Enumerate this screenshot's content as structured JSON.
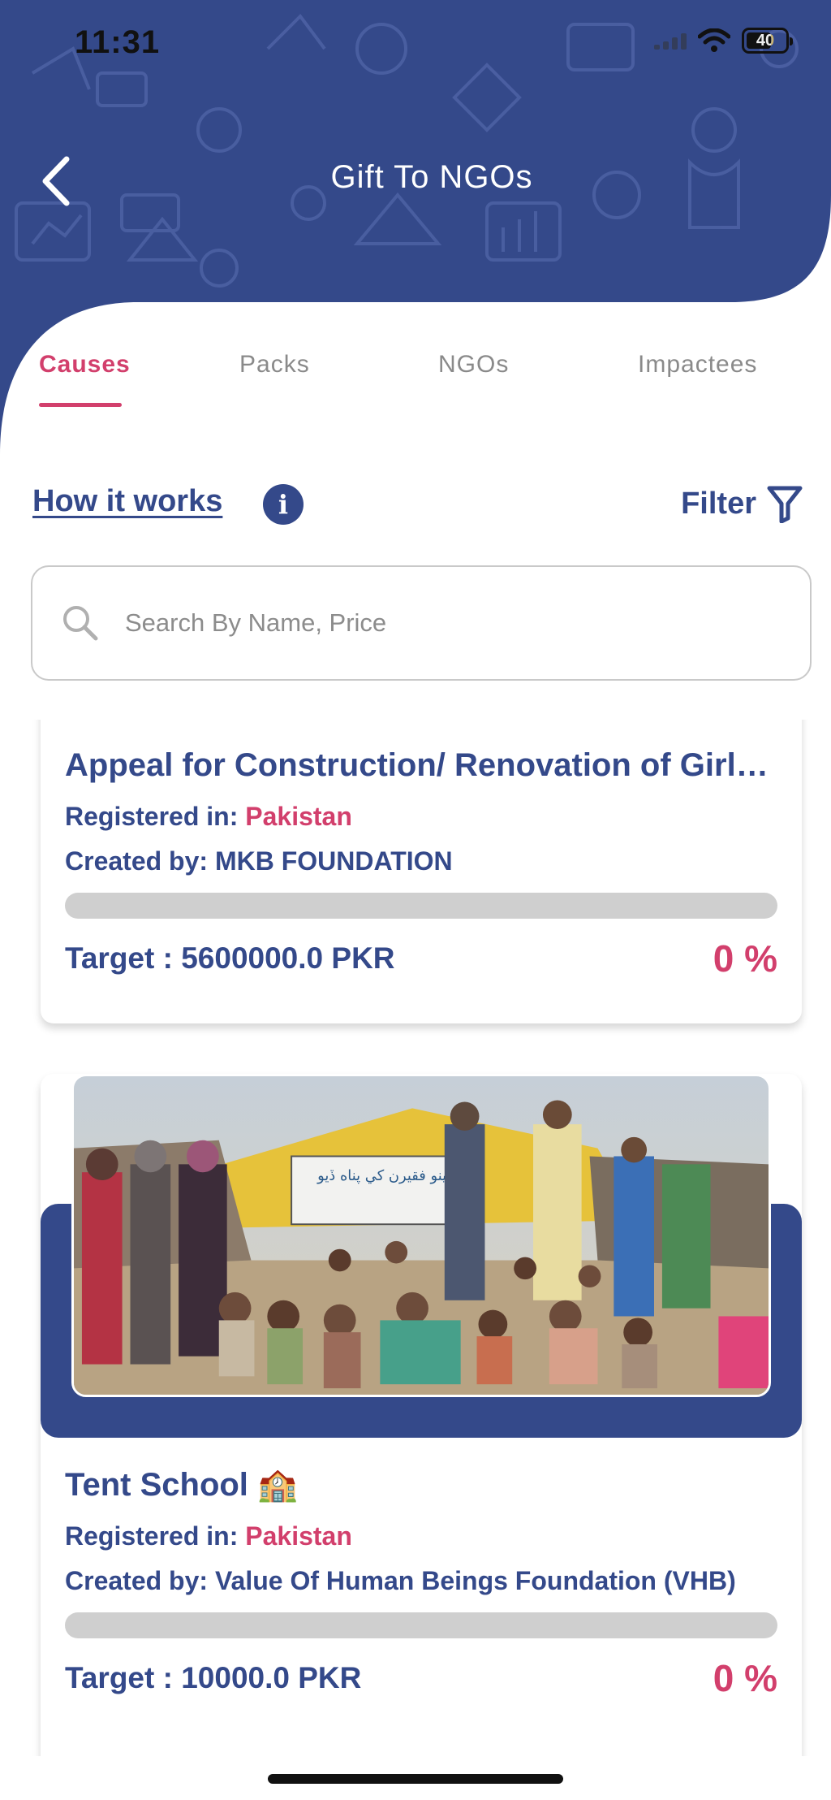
{
  "status_bar": {
    "time": "11:31",
    "battery": "40"
  },
  "header": {
    "title": "Gift To NGOs"
  },
  "tabs": [
    {
      "label": "Causes",
      "active": true
    },
    {
      "label": "Packs",
      "active": false
    },
    {
      "label": "NGOs",
      "active": false
    },
    {
      "label": "Impactees",
      "active": false
    }
  ],
  "toolbar": {
    "how_it_works": "How it works",
    "filter": "Filter"
  },
  "search": {
    "placeholder": "Search By Name, Price",
    "value": ""
  },
  "causes": [
    {
      "title": "Appeal for Construction/ Renovation of Girls…",
      "registered_label": "Registered in: ",
      "country": "Pakistan",
      "created_by": "Created by: MKB FOUNDATION",
      "target": "Target : 5600000.0 PKR",
      "progress_percent": 0,
      "percent_label": "0 %"
    },
    {
      "title": "Tent School 🏫",
      "registered_label": "Registered in: ",
      "country": "Pakistan",
      "created_by": "Created by: Value Of Human Beings Foundation (VHB)",
      "target": "Target : 10000.0 PKR",
      "progress_percent": 0,
      "percent_label": "0 %",
      "image_banner_text": "پينو فقيرن کي پناه ڏيو"
    }
  ],
  "colors": {
    "primary": "#34498a",
    "accent": "#d23f6c",
    "progress_track": "#cfcfcf"
  }
}
